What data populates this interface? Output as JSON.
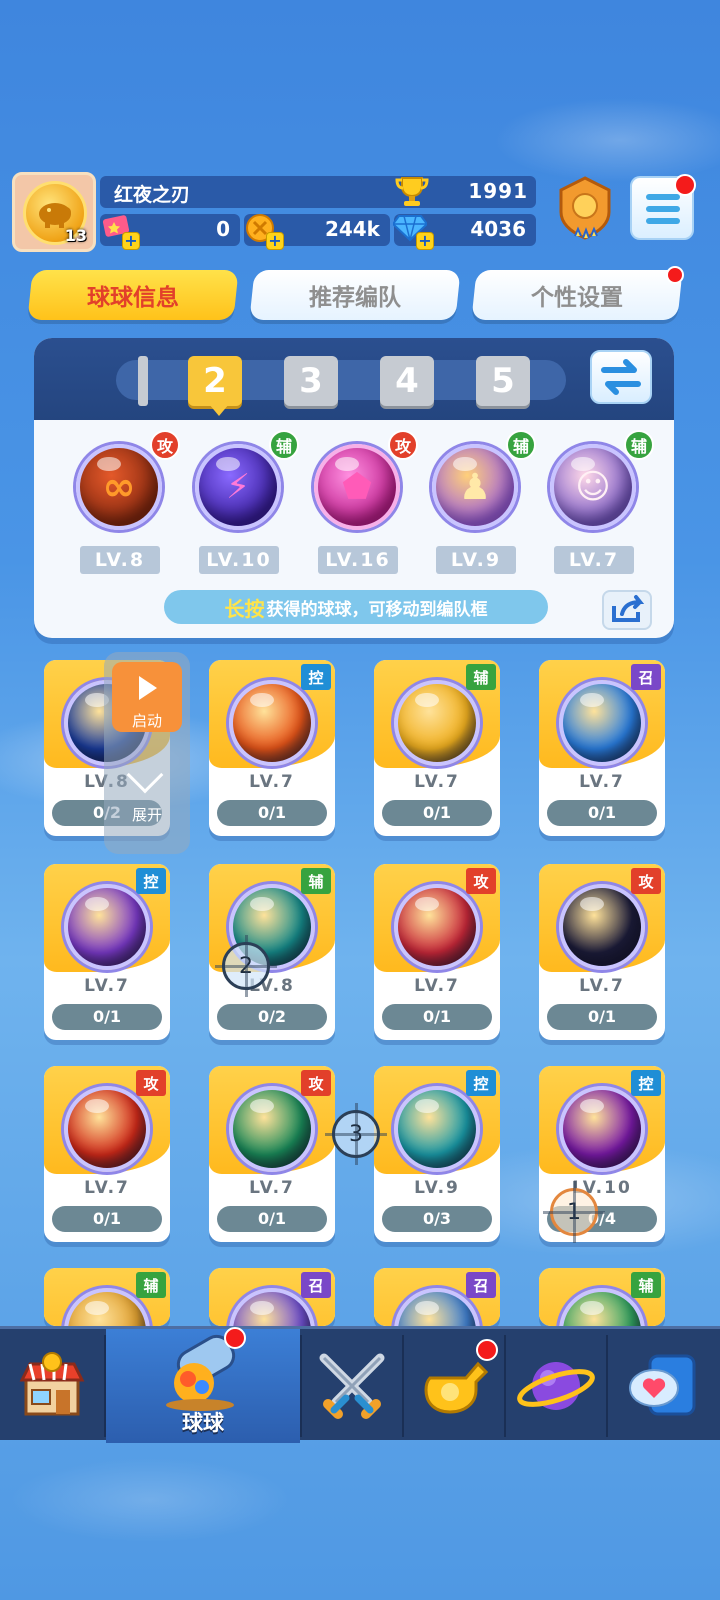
{
  "header": {
    "player_name": "红夜之刃",
    "player_level": "13",
    "trophies": "1991",
    "resources": [
      {
        "icon": "ticket-icon",
        "value": "0"
      },
      {
        "icon": "gold-coin-icon",
        "value": "244k"
      },
      {
        "icon": "diamond-icon",
        "value": "4036"
      }
    ]
  },
  "tabs": [
    {
      "label": "球球信息",
      "active": true
    },
    {
      "label": "推荐编队",
      "active": false
    },
    {
      "label": "个性设置",
      "active": false
    }
  ],
  "team": {
    "slots": [
      "2",
      "3",
      "4",
      "5"
    ],
    "active_slot": "2",
    "balls": [
      {
        "name": "infinity-ball",
        "role": "攻",
        "level": "LV.8",
        "color": "#8a2a10"
      },
      {
        "name": "lightning-ball",
        "role": "辅",
        "level": "LV.10",
        "color": "#4b2fb8"
      },
      {
        "name": "shield-ball",
        "role": "攻",
        "level": "LV.16",
        "color": "#e23fb5"
      },
      {
        "name": "clone-ball",
        "role": "辅",
        "level": "LV.9",
        "color": "#9d5ce0"
      },
      {
        "name": "girl-ball",
        "role": "辅",
        "level": "LV.7",
        "color": "#8b6ad0"
      }
    ],
    "hint_highlight": "长按",
    "hint_text": "获得的球球，可移动到编队框"
  },
  "cards": [
    {
      "name": "penguin-ball",
      "role": "",
      "level": "LV.8",
      "count": "0/2",
      "color": "#1a3c9c"
    },
    {
      "name": "star-ball",
      "role": "控",
      "level": "LV.7",
      "count": "0/1",
      "color": "#e8561a"
    },
    {
      "name": "sun-ball",
      "role": "辅",
      "level": "LV.7",
      "count": "0/1",
      "color": "#f0b020"
    },
    {
      "name": "potion-ball",
      "role": "召",
      "level": "LV.7",
      "count": "0/1",
      "color": "#2a7ee0"
    },
    {
      "name": "book-ball",
      "role": "控",
      "level": "LV.7",
      "count": "0/1",
      "color": "#7a3ac8"
    },
    {
      "name": "dragon-ball",
      "role": "辅",
      "level": "LV.8",
      "count": "0/2",
      "color": "#168a8a"
    },
    {
      "name": "prism-ball",
      "role": "攻",
      "level": "LV.7",
      "count": "0/1",
      "color": "#c8283a"
    },
    {
      "name": "venom-ball",
      "role": "攻",
      "level": "LV.7",
      "count": "0/1",
      "color": "#1c1c3a"
    },
    {
      "name": "phoenix-ball",
      "role": "攻",
      "level": "LV.7",
      "count": "0/1",
      "color": "#d02a1a"
    },
    {
      "name": "bow-ball",
      "role": "攻",
      "level": "LV.7",
      "count": "0/1",
      "color": "#1a8a5a"
    },
    {
      "name": "wave-ball",
      "role": "控",
      "level": "LV.9",
      "count": "0/3",
      "color": "#1a9aa8"
    },
    {
      "name": "rune-ball",
      "role": "控",
      "level": "LV.10",
      "count": "0/4",
      "color": "#7a1aa8"
    },
    {
      "name": "partial-ball-1",
      "role": "辅",
      "level": "",
      "count": "",
      "color": "#e0a030"
    },
    {
      "name": "partial-ball-2",
      "role": "召",
      "level": "",
      "count": "",
      "color": "#7050d0"
    },
    {
      "name": "partial-ball-3",
      "role": "召",
      "level": "",
      "count": "",
      "color": "#4080d0"
    },
    {
      "name": "partial-ball-4",
      "role": "辅",
      "level": "",
      "count": "",
      "color": "#30a060"
    }
  ],
  "float_panel": {
    "launch_label": "启动",
    "expand_label": "展开"
  },
  "markers": [
    "2",
    "3",
    "1"
  ],
  "bottom_nav": [
    {
      "icon": "shop-icon",
      "label": ""
    },
    {
      "icon": "cannon-icon",
      "label": "球球",
      "active": true
    },
    {
      "icon": "crossed-swords-icon",
      "label": ""
    },
    {
      "icon": "whistle-icon",
      "label": ""
    },
    {
      "icon": "planet-icon",
      "label": ""
    },
    {
      "icon": "chat-heart-icon",
      "label": ""
    }
  ],
  "colors": {
    "attack": "#e2402a",
    "support": "#37a33f",
    "control": "#1f8ed6",
    "summon": "#7a48c8",
    "tab_active": "#ffc21a"
  }
}
